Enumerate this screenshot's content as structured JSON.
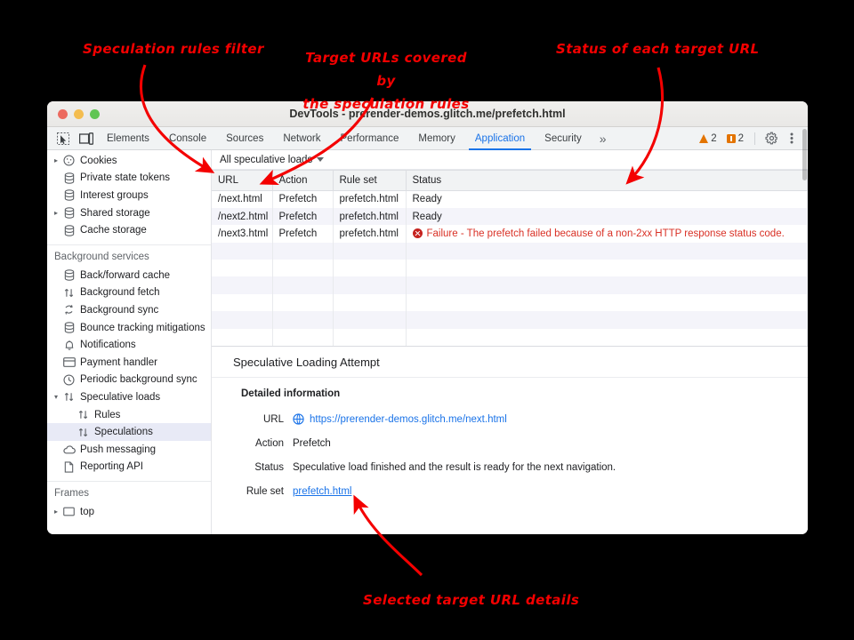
{
  "window": {
    "title": "DevTools - prerender-demos.glitch.me/prefetch.html",
    "traffic_lights": [
      "close-red",
      "minimize-yellow",
      "maximize-green"
    ]
  },
  "toolbar": {
    "icons": [
      "inspect-element-icon",
      "device-toolbar-icon"
    ],
    "tabs": [
      {
        "label": "Elements",
        "active": false
      },
      {
        "label": "Console",
        "active": false
      },
      {
        "label": "Sources",
        "active": false
      },
      {
        "label": "Network",
        "active": false
      },
      {
        "label": "Performance",
        "active": false
      },
      {
        "label": "Memory",
        "active": false
      },
      {
        "label": "Application",
        "active": true
      },
      {
        "label": "Security",
        "active": false
      }
    ],
    "more_tabs_label": "»",
    "warnings_count": "2",
    "issues_count": "2",
    "settings_icon": "gear-icon",
    "menu_icon": "kebab-menu-icon"
  },
  "sidebar": {
    "storage_items": [
      {
        "label": "Cookies",
        "icon": "cookie-icon",
        "twisty": "▸",
        "indent": 0,
        "selected": false
      },
      {
        "label": "Private state tokens",
        "icon": "database-icon",
        "twisty": "",
        "indent": 0,
        "selected": false
      },
      {
        "label": "Interest groups",
        "icon": "database-icon",
        "twisty": "",
        "indent": 0,
        "selected": false
      },
      {
        "label": "Shared storage",
        "icon": "database-icon",
        "twisty": "▸",
        "indent": 0,
        "selected": false
      },
      {
        "label": "Cache storage",
        "icon": "database-icon",
        "twisty": "",
        "indent": 0,
        "selected": false
      }
    ],
    "background_services_header": "Background services",
    "background_items": [
      {
        "label": "Back/forward cache",
        "icon": "database-icon",
        "twisty": "",
        "indent": 0,
        "selected": false
      },
      {
        "label": "Background fetch",
        "icon": "updown-arrows-icon",
        "twisty": "",
        "indent": 0,
        "selected": false
      },
      {
        "label": "Background sync",
        "icon": "sync-icon",
        "twisty": "",
        "indent": 0,
        "selected": false
      },
      {
        "label": "Bounce tracking mitigations",
        "icon": "database-icon",
        "twisty": "",
        "indent": 0,
        "selected": false
      },
      {
        "label": "Notifications",
        "icon": "bell-icon",
        "twisty": "",
        "indent": 0,
        "selected": false
      },
      {
        "label": "Payment handler",
        "icon": "card-icon",
        "twisty": "",
        "indent": 0,
        "selected": false
      },
      {
        "label": "Periodic background sync",
        "icon": "clock-icon",
        "twisty": "",
        "indent": 0,
        "selected": false
      },
      {
        "label": "Speculative loads",
        "icon": "updown-arrows-icon",
        "twisty": "▾",
        "indent": 0,
        "selected": false
      },
      {
        "label": "Rules",
        "icon": "updown-arrows-icon",
        "twisty": "",
        "indent": 1,
        "selected": false
      },
      {
        "label": "Speculations",
        "icon": "updown-arrows-icon",
        "twisty": "",
        "indent": 1,
        "selected": true
      },
      {
        "label": "Push messaging",
        "icon": "cloud-icon",
        "twisty": "",
        "indent": 0,
        "selected": false
      },
      {
        "label": "Reporting API",
        "icon": "page-icon",
        "twisty": "",
        "indent": 0,
        "selected": false
      }
    ],
    "frames_header": "Frames",
    "frames_items": [
      {
        "label": "top",
        "icon": "frame-icon",
        "twisty": "▸",
        "indent": 0,
        "selected": false
      }
    ]
  },
  "filter": {
    "label": "All speculative loads",
    "caret": "chevron-down-icon"
  },
  "table": {
    "columns": [
      "URL",
      "Action",
      "Rule set",
      "Status"
    ],
    "rows": [
      {
        "url": "/next.html",
        "action": "Prefetch",
        "rule_set": "prefetch.html",
        "status": "Ready",
        "error": false
      },
      {
        "url": "/next2.html",
        "action": "Prefetch",
        "rule_set": "prefetch.html",
        "status": "Ready",
        "error": false
      },
      {
        "url": "/next3.html",
        "action": "Prefetch",
        "rule_set": "prefetch.html",
        "status": "Failure - The prefetch failed because of a non-2xx HTTP response status code.",
        "error": true
      }
    ]
  },
  "details": {
    "title": "Speculative Loading Attempt",
    "section_header": "Detailed information",
    "rows": [
      {
        "key": "URL",
        "value": "https://prerender-demos.glitch.me/next.html",
        "style": "link-globe"
      },
      {
        "key": "Action",
        "value": "Prefetch",
        "style": "plain"
      },
      {
        "key": "Status",
        "value": "Speculative load finished and the result is ready for the next navigation.",
        "style": "plain"
      },
      {
        "key": "Rule set",
        "value": "prefetch.html",
        "style": "link-underline"
      }
    ]
  },
  "annotations": {
    "color": "#f40000",
    "items": [
      {
        "name": "annotation-filter",
        "lines": [
          "Speculation rules filter"
        ]
      },
      {
        "name": "annotation-urls",
        "lines": [
          "Target URLs covered by",
          "the speculation rules"
        ]
      },
      {
        "name": "annotation-status",
        "lines": [
          "Status of each target URL"
        ]
      },
      {
        "name": "annotation-details",
        "lines": [
          "Selected target URL details"
        ]
      }
    ]
  }
}
